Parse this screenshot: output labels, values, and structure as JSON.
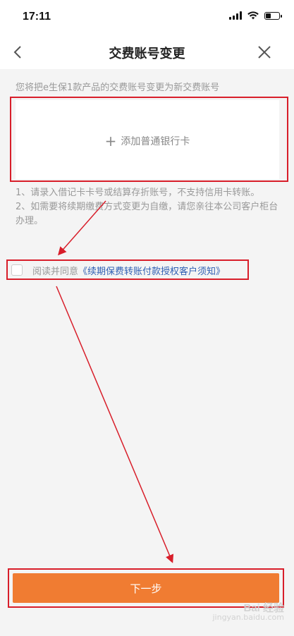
{
  "status_bar": {
    "time": "17:11"
  },
  "nav": {
    "title": "交费账号变更"
  },
  "intro_text": "您将把e生保1款产品的交费账号变更为新交费账号",
  "add_card": {
    "plus": "+",
    "label": "添加普通银行卡"
  },
  "notes": [
    "1、请录入借记卡卡号或结算存折账号，不支持信用卡转账。",
    "2、如需要将续期缴费方式变更为自缴，请您亲往本公司客户柜台办理。"
  ],
  "agreement": {
    "prefix": "阅读并同意",
    "link": "《续期保费转账付款授权客户须知》"
  },
  "next_button": "下一步",
  "watermark": {
    "brand": "Bai 经验",
    "sub": "jingyan.baidu.com"
  },
  "colors": {
    "accent": "#f07c32",
    "link": "#2f5fb3",
    "annotation": "#d81e2a"
  }
}
